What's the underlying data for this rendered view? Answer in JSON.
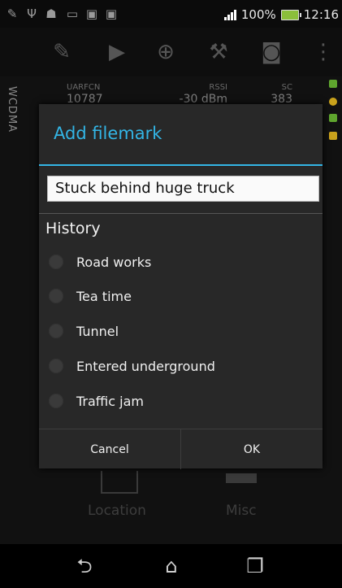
{
  "status": {
    "battery": "100%",
    "time": "12:16"
  },
  "info": {
    "technology": "WCDMA",
    "uarfcn_label": "UARFCN",
    "uarfcn_value": "10787",
    "rssi_label": "RSSI",
    "rssi_value": "-30 dBm",
    "sc_label": "SC",
    "sc_value": "383"
  },
  "lower": {
    "location_label": "Location",
    "misc_label": "Misc"
  },
  "dialog": {
    "title": "Add filemark",
    "input_value": "Stuck behind huge truck",
    "history_title": "History",
    "history_items": [
      "Road works",
      "Tea time",
      "Tunnel",
      "Entered underground",
      "Traffic jam"
    ],
    "cancel_label": "Cancel",
    "ok_label": "OK"
  },
  "colors": {
    "accent": "#33b5e5",
    "battery": "#8bbf3b"
  }
}
